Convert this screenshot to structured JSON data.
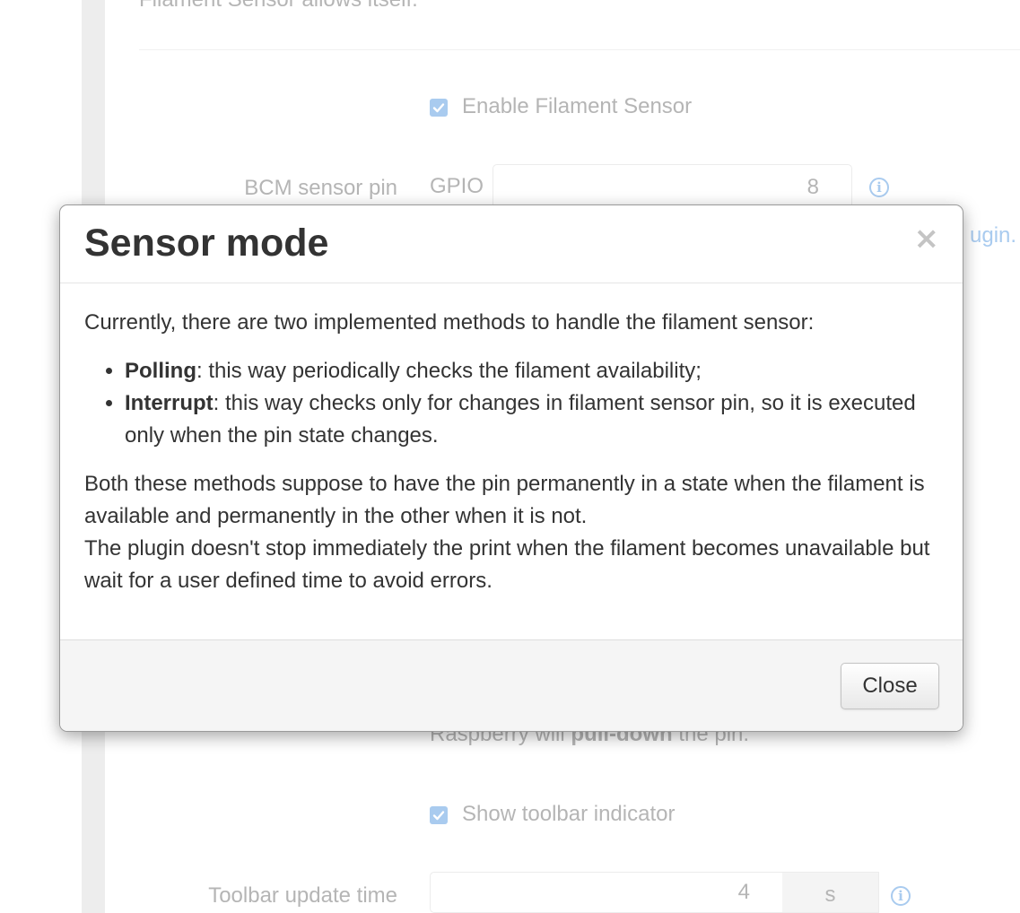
{
  "background": {
    "intro_text": "Filament Sensor allows itself.",
    "enable_checkbox": {
      "label": "Enable Filament Sensor",
      "checked": true
    },
    "bcm_pin": {
      "label": "BCM sensor pin",
      "prefix": "GPIO",
      "value": "8"
    },
    "plugin_link_text": "ugin.",
    "pull_note_prefix": "Raspberry will ",
    "pull_note_bold": "pull-down",
    "pull_note_suffix": " the pin.",
    "toolbar_checkbox": {
      "label": "Show toolbar indicator",
      "checked": true
    },
    "toolbar_update": {
      "label": "Toolbar update time",
      "value": "4",
      "unit": "s"
    },
    "info_icon_glyph": "i"
  },
  "modal": {
    "title": "Sensor mode",
    "close_glyph": "×",
    "intro": "Currently, there are two implemented methods to handle the filament sensor:",
    "methods": [
      {
        "name": "Polling",
        "description": ": this way periodically checks the filament availability;"
      },
      {
        "name": "Interrupt",
        "description": ": this way checks only for changes in filament sensor pin, so it is executed only when the pin state changes."
      }
    ],
    "paragraph_1": "Both these methods suppose to have the pin permanently in a state when the filament is available and permanently in the other when it is not.",
    "paragraph_2": "The plugin doesn't stop immediately the print when the filament becomes unavailable but wait for a user defined time to avoid errors.",
    "close_button_label": "Close"
  },
  "colors": {
    "checkbox": "#a9cbef",
    "faded_text": "#b5b5b5",
    "modal_text": "#333333",
    "footer_bg": "#f5f5f5"
  }
}
